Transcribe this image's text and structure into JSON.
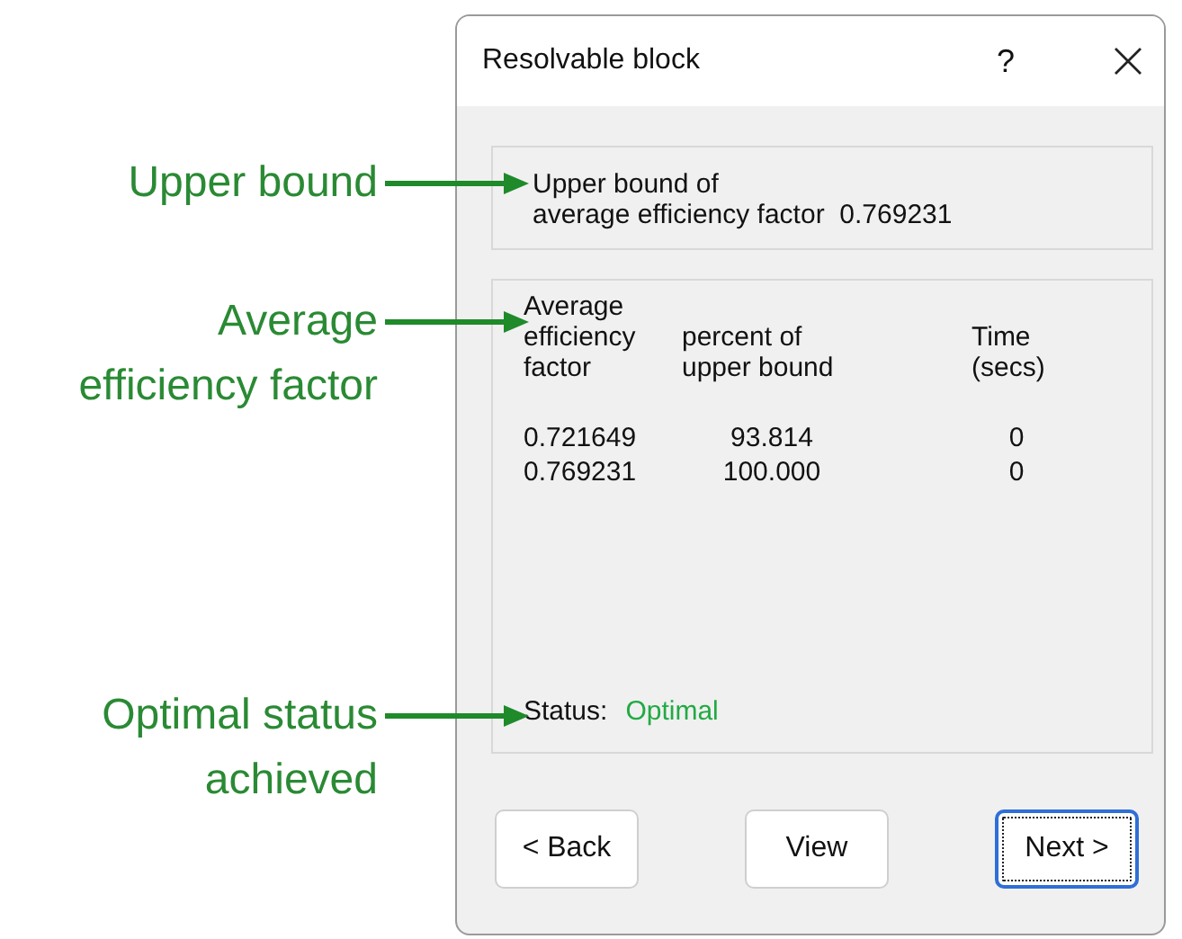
{
  "annotations": [
    {
      "lines": [
        "Upper bound"
      ]
    },
    {
      "lines": [
        "Average",
        "efficiency factor"
      ]
    },
    {
      "lines": [
        "Optimal status",
        "achieved"
      ]
    }
  ],
  "dialog": {
    "title": "Resolvable block",
    "help": "?",
    "upper_bound": {
      "lines": [
        "Upper bound of",
        "average efficiency factor"
      ],
      "value": "0.769231"
    },
    "results": {
      "columns": [
        {
          "lines": [
            "Average",
            "efficiency",
            "factor"
          ]
        },
        {
          "lines": [
            "percent of",
            "upper bound"
          ]
        },
        {
          "lines": [
            "Time",
            "(secs)"
          ]
        }
      ],
      "rows": [
        [
          "0.721649",
          "93.814",
          "0"
        ],
        [
          "0.769231",
          "100.000",
          "0"
        ]
      ],
      "status": {
        "label": "Status:",
        "value": "Optimal"
      }
    },
    "buttons": [
      {
        "label": "< Back",
        "focused": false
      },
      {
        "label": "View",
        "focused": false
      },
      {
        "label": "Next >",
        "focused": true
      }
    ]
  }
}
